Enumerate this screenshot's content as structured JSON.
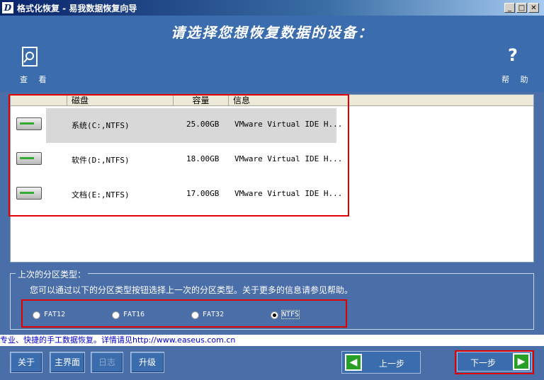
{
  "window": {
    "title": "格式化恢复 - 易我数据恢复向导",
    "icon_letter": "D"
  },
  "header": {
    "title": "请选择您想恢复数据的设备：",
    "view_label": "查 看",
    "help_label": "帮 助"
  },
  "list": {
    "columns": [
      "磁盘",
      "容量",
      "信息"
    ],
    "rows": [
      {
        "name": "系统(C:,NTFS)",
        "size": "25.00GB",
        "info": "VMware Virtual IDE H..."
      },
      {
        "name": "软件(D:,NTFS)",
        "size": "18.00GB",
        "info": "VMware Virtual IDE H..."
      },
      {
        "name": "文档(E:,NTFS)",
        "size": "17.00GB",
        "info": "VMware Virtual IDE H..."
      }
    ]
  },
  "partition": {
    "label": "上次的分区类型：",
    "description": "您可以通过以下的分区类型按钮选择上一次的分区类型。关于更多的信息请参见帮助。",
    "options": [
      "FAT12",
      "FAT16",
      "FAT32",
      "NTFS"
    ],
    "selected": "NTFS"
  },
  "strip_text": "专业、快捷的手工数据恢复。详情请见http://www.easeus.com.cn",
  "buttons": {
    "about": "关于",
    "main": "主界面",
    "log": "日志",
    "upgrade": "升级",
    "prev": "上一步",
    "next": "下一步"
  },
  "colors": {
    "background": "#4a6ea8",
    "header": "#3a6cae",
    "highlight_box": "#e00000",
    "next_arrow": "#28a028"
  }
}
